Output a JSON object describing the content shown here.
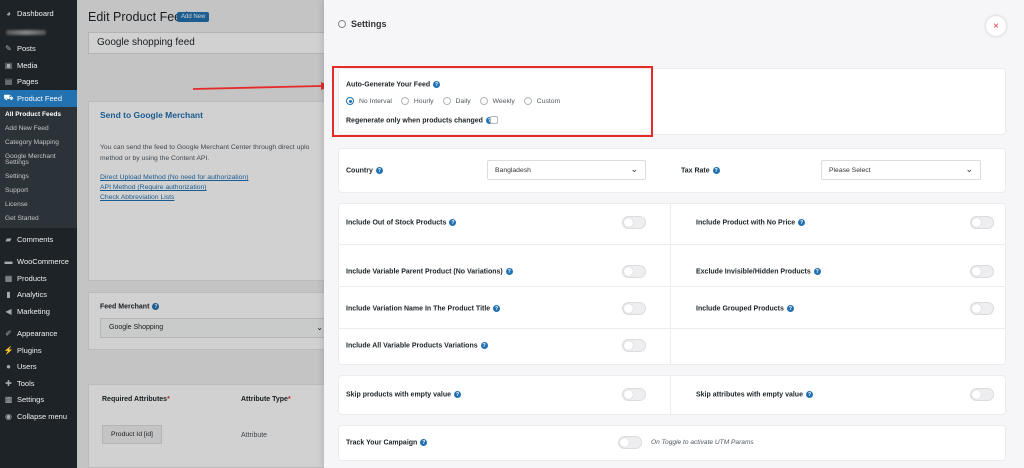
{
  "sidebar": {
    "dashboard": "Dashboard",
    "posts": "Posts",
    "media": "Media",
    "pages": "Pages",
    "product_feed": "Product Feed",
    "submenu": [
      "All Product Feeds",
      "Add New Feed",
      "Category Mapping",
      "Google Merchant Settings",
      "Settings",
      "Support",
      "License",
      "Get Started"
    ],
    "comments": "Comments",
    "woocommerce": "WooCommerce",
    "products": "Products",
    "analytics": "Analytics",
    "marketing": "Marketing",
    "appearance": "Appearance",
    "plugins": "Plugins",
    "users": "Users",
    "tools": "Tools",
    "settings": "Settings",
    "collapse": "Collapse menu"
  },
  "page": {
    "title": "Edit Product Feed",
    "add_new": "Add New",
    "feed_name": "Google shopping feed"
  },
  "google_merchant": {
    "title": "Send to Google Merchant",
    "text": "You can send the feed to Google Merchant Center through direct uplo method or by using the Content API.",
    "link1": "Direct Upload Method (No need for authorization)",
    "link2": "API Method (Require authorization)",
    "link3": "Check Abbreviation Lists"
  },
  "merchant": {
    "label": "Feed Merchant",
    "value": "Google Shopping"
  },
  "attributes": {
    "header_required": "Required Attributes",
    "header_type": "Attribute Type",
    "row_attr": "Product Id [id]",
    "row_type": "Attribute"
  },
  "drawer": {
    "title": "Settings",
    "close": "×",
    "auto_generate_label": "Auto-Generate Your Feed",
    "intervals": [
      "No Interval",
      "Hourly",
      "Daily",
      "Weekly",
      "Custom"
    ],
    "selected_interval": "No Interval",
    "regenerate_label": "Regenerate only when products changed",
    "country_label": "Country",
    "country_value": "Bangladesh",
    "tax_label": "Tax Rate",
    "tax_value": "Please Select",
    "options_left": [
      "Include Out of Stock Products",
      "Include Variable Parent Product (No Variations)",
      "Include Variation Name In The Product Title",
      "Include All Variable Products Variations"
    ],
    "options_right": [
      "Include Product with No Price",
      "Exclude Invisible/Hidden Products",
      "Include Grouped Products"
    ],
    "skip_left": "Skip products with empty value",
    "skip_right": "Skip attributes with empty value",
    "track_label": "Track Your Campaign",
    "utm_hint": "On Toggle to activate UTM Params"
  },
  "colors": {
    "wp_blue": "#2271b1",
    "sidebar_bg": "#1d2327",
    "highlight_red": "#e52a2a"
  }
}
